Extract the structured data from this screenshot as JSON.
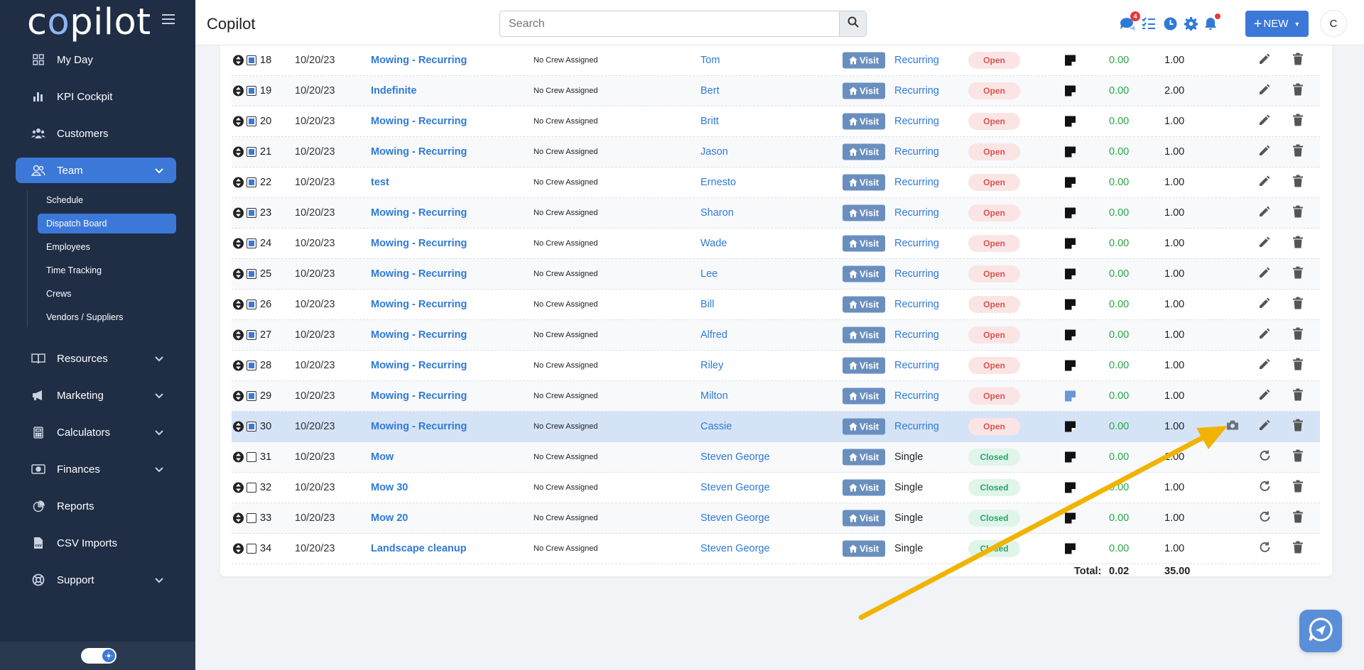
{
  "app": {
    "logo_pre": "c",
    "logo_o": "o",
    "logo_post": "pilot",
    "title": "Copilot"
  },
  "colors": {
    "sidebar_bg": "#1f2d45",
    "accent": "#3c78d8",
    "link": "#2f7ad6",
    "open_status": "#d9534f",
    "closed_status": "#28a46a",
    "cost_green": "#28a745",
    "annotation_arrow": "#f0b400"
  },
  "sidebar": {
    "items": [
      {
        "label": "My Day",
        "icon": "grid-icon"
      },
      {
        "label": "KPI Cockpit",
        "icon": "bar-chart-icon"
      },
      {
        "label": "Customers",
        "icon": "users-icon"
      },
      {
        "label": "Team",
        "icon": "user-group-icon",
        "expanded": true
      },
      {
        "label": "Resources",
        "icon": "book-icon"
      },
      {
        "label": "Marketing",
        "icon": "megaphone-icon"
      },
      {
        "label": "Calculators",
        "icon": "calculator-icon"
      },
      {
        "label": "Finances",
        "icon": "money-icon"
      },
      {
        "label": "Reports",
        "icon": "pie-chart-icon"
      },
      {
        "label": "CSV Imports",
        "icon": "csv-file-icon"
      },
      {
        "label": "Support",
        "icon": "lifebuoy-icon"
      }
    ],
    "team_subitems": [
      "Schedule",
      "Dispatch Board",
      "Employees",
      "Time Tracking",
      "Crews",
      "Vendors / Suppliers"
    ],
    "active_subitem": "Dispatch Board"
  },
  "header": {
    "search_placeholder": "Search",
    "messages_badge": "4",
    "new_label": "NEW",
    "avatar_initial": "C"
  },
  "table": {
    "visit_label": "Visit",
    "rows": [
      {
        "num": "18",
        "date": "10/20/23",
        "title": "Mowing - Recurring",
        "crew": "No Crew Assigned",
        "customer": "Tom",
        "frequency": "Recurring",
        "status": "Open",
        "cost": "0.00",
        "hours": "1.00"
      },
      {
        "num": "19",
        "date": "10/20/23",
        "title": "Indefinite",
        "crew": "No Crew Assigned",
        "customer": "Bert",
        "frequency": "Recurring",
        "status": "Open",
        "cost": "0.00",
        "hours": "2.00"
      },
      {
        "num": "20",
        "date": "10/20/23",
        "title": "Mowing - Recurring",
        "crew": "No Crew Assigned",
        "customer": "Britt",
        "frequency": "Recurring",
        "status": "Open",
        "cost": "0.00",
        "hours": "1.00"
      },
      {
        "num": "21",
        "date": "10/20/23",
        "title": "Mowing - Recurring",
        "crew": "No Crew Assigned",
        "customer": "Jason",
        "frequency": "Recurring",
        "status": "Open",
        "cost": "0.00",
        "hours": "1.00"
      },
      {
        "num": "22",
        "date": "10/20/23",
        "title": "test",
        "crew": "No Crew Assigned",
        "customer": "Ernesto",
        "frequency": "Recurring",
        "status": "Open",
        "cost": "0.00",
        "hours": "1.00"
      },
      {
        "num": "23",
        "date": "10/20/23",
        "title": "Mowing - Recurring",
        "crew": "No Crew Assigned",
        "customer": "Sharon",
        "frequency": "Recurring",
        "status": "Open",
        "cost": "0.00",
        "hours": "1.00"
      },
      {
        "num": "24",
        "date": "10/20/23",
        "title": "Mowing - Recurring",
        "crew": "No Crew Assigned",
        "customer": "Wade",
        "frequency": "Recurring",
        "status": "Open",
        "cost": "0.00",
        "hours": "1.00"
      },
      {
        "num": "25",
        "date": "10/20/23",
        "title": "Mowing - Recurring",
        "crew": "No Crew Assigned",
        "customer": "Lee",
        "frequency": "Recurring",
        "status": "Open",
        "cost": "0.00",
        "hours": "1.00"
      },
      {
        "num": "26",
        "date": "10/20/23",
        "title": "Mowing - Recurring",
        "crew": "No Crew Assigned",
        "customer": "Bill",
        "frequency": "Recurring",
        "status": "Open",
        "cost": "0.00",
        "hours": "1.00"
      },
      {
        "num": "27",
        "date": "10/20/23",
        "title": "Mowing - Recurring",
        "crew": "No Crew Assigned",
        "customer": "Alfred",
        "frequency": "Recurring",
        "status": "Open",
        "cost": "0.00",
        "hours": "1.00"
      },
      {
        "num": "28",
        "date": "10/20/23",
        "title": "Mowing - Recurring",
        "crew": "No Crew Assigned",
        "customer": "Riley",
        "frequency": "Recurring",
        "status": "Open",
        "cost": "0.00",
        "hours": "1.00"
      },
      {
        "num": "29",
        "date": "10/20/23",
        "title": "Mowing - Recurring",
        "crew": "No Crew Assigned",
        "customer": "Milton",
        "frequency": "Recurring",
        "status": "Open",
        "cost": "0.00",
        "hours": "1.00"
      },
      {
        "num": "30",
        "date": "10/20/23",
        "title": "Mowing - Recurring",
        "crew": "No Crew Assigned",
        "customer": "Cassie",
        "frequency": "Recurring",
        "status": "Open",
        "cost": "0.00",
        "hours": "1.00"
      },
      {
        "num": "31",
        "date": "10/20/23",
        "title": "Mow",
        "crew": "No Crew Assigned",
        "customer": "Steven George",
        "frequency": "Single",
        "status": "Closed",
        "cost": "0.00",
        "hours": "1.00"
      },
      {
        "num": "32",
        "date": "10/20/23",
        "title": "Mow 30",
        "crew": "No Crew Assigned",
        "customer": "Steven George",
        "frequency": "Single",
        "status": "Closed",
        "cost": "0.00",
        "hours": "1.00"
      },
      {
        "num": "33",
        "date": "10/20/23",
        "title": "Mow 20",
        "crew": "No Crew Assigned",
        "customer": "Steven George",
        "frequency": "Single",
        "status": "Closed",
        "cost": "0.00",
        "hours": "1.00"
      },
      {
        "num": "34",
        "date": "10/20/23",
        "title": "Landscape cleanup",
        "crew": "No Crew Assigned",
        "customer": "Steven George",
        "frequency": "Single",
        "status": "Closed",
        "cost": "0.00",
        "hours": "1.00"
      }
    ],
    "total_label": "Total:",
    "total_cost": "0.02",
    "total_hours": "35.00"
  }
}
